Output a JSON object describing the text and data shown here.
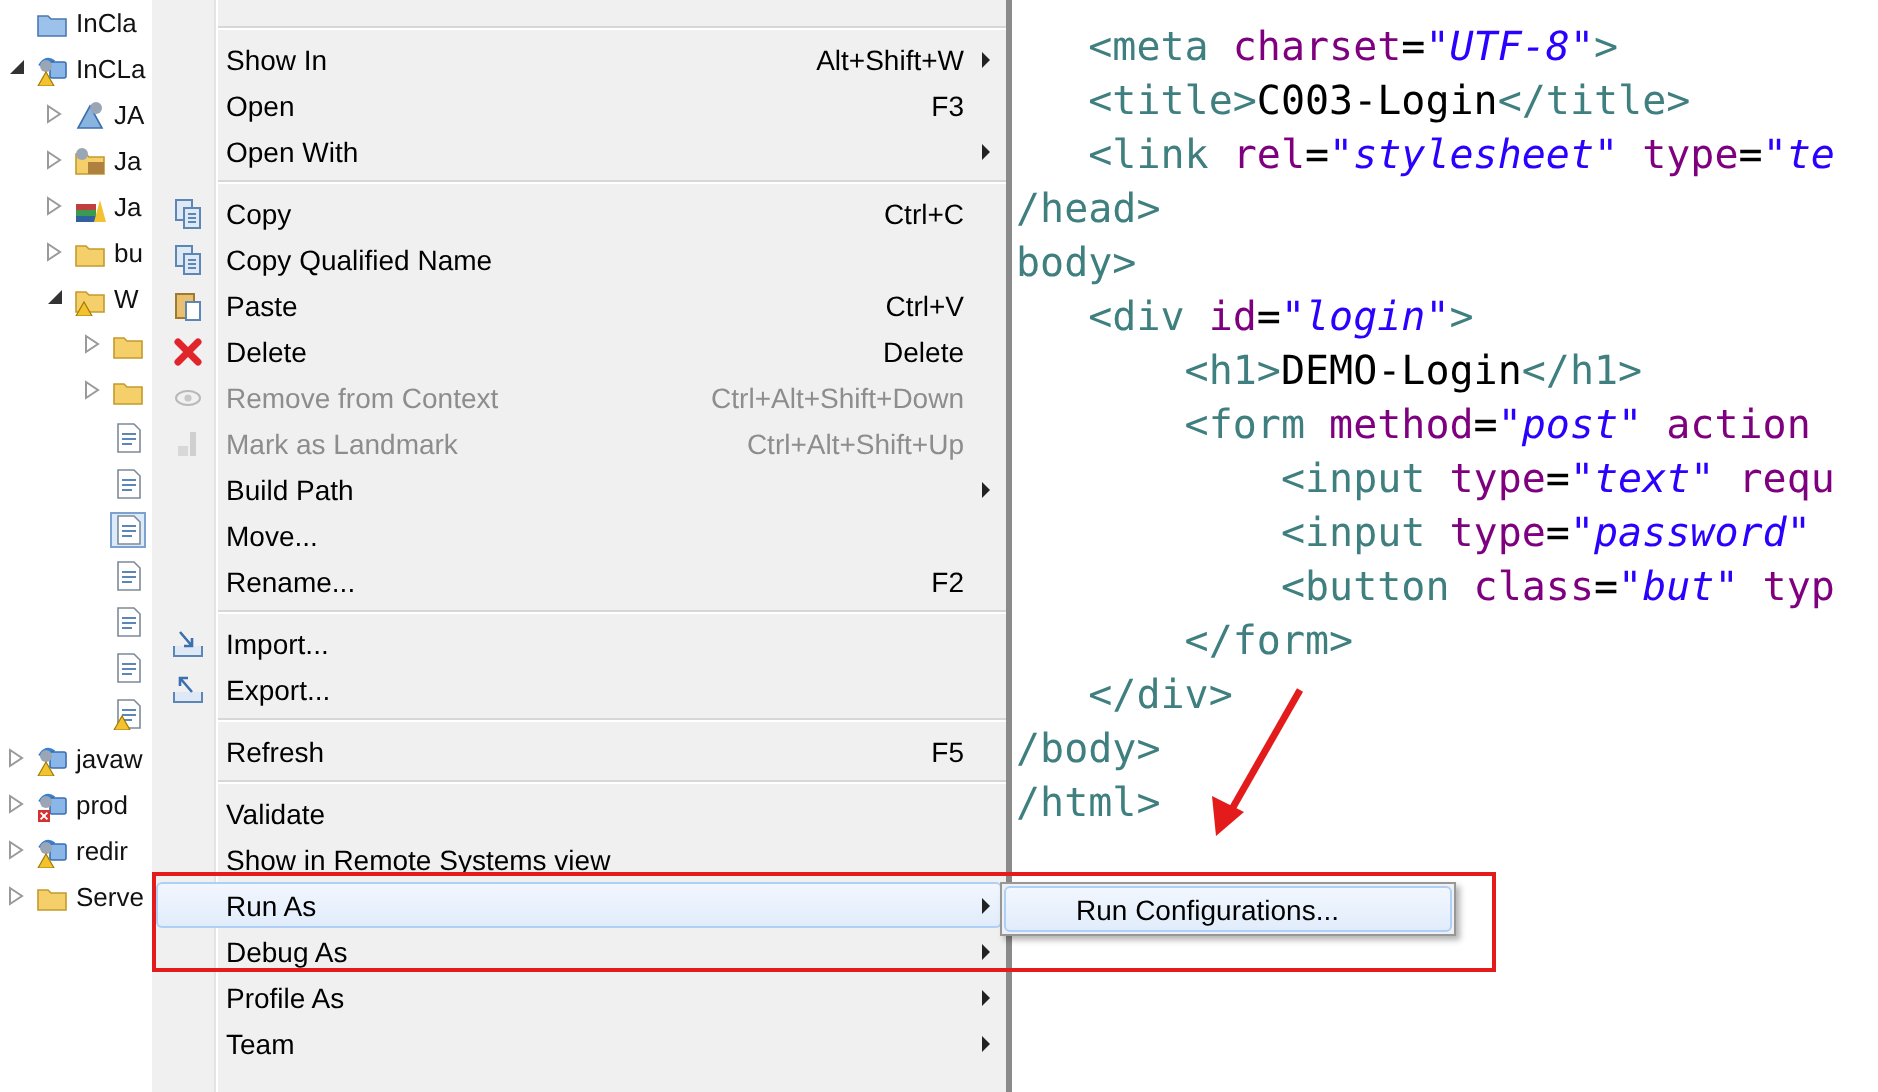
{
  "tree": [
    {
      "label": "InCla",
      "kind": "closed-project",
      "selected": false
    },
    {
      "label": "InCLa",
      "kind": "project-warning",
      "selected": false,
      "expanded": true,
      "children": [
        {
          "label": "JA",
          "kind": "service",
          "selected": false,
          "expanded": false
        },
        {
          "label": "Ja",
          "kind": "resources",
          "selected": false,
          "expanded": false
        },
        {
          "label": "Ja",
          "kind": "library",
          "selected": false,
          "expanded": false
        },
        {
          "label": "bu",
          "kind": "folder",
          "selected": false,
          "expanded": false
        },
        {
          "label": "W",
          "kind": "folder-warning",
          "selected": false,
          "expanded": true,
          "children": [
            {
              "kind": "folder",
              "selected": false,
              "expanded": false
            },
            {
              "kind": "folder",
              "selected": false,
              "expanded": false
            },
            {
              "kind": "file",
              "selected": false
            },
            {
              "kind": "file",
              "selected": false
            },
            {
              "kind": "file",
              "selected": true
            },
            {
              "kind": "file",
              "selected": false
            },
            {
              "kind": "file",
              "selected": false
            },
            {
              "kind": "file",
              "selected": false
            },
            {
              "kind": "file-warning",
              "selected": false
            }
          ]
        }
      ]
    },
    {
      "label": "javaw",
      "kind": "project-warning",
      "selected": false,
      "expanded": false
    },
    {
      "label": "prod",
      "kind": "project-error",
      "selected": false,
      "expanded": false
    },
    {
      "label": "redir",
      "kind": "project-warning",
      "selected": false,
      "expanded": false
    },
    {
      "label": "Serve",
      "kind": "folder",
      "selected": false,
      "expanded": false
    }
  ],
  "menu": {
    "items": [
      {
        "kind": "separator"
      },
      {
        "kind": "item",
        "label": "Show In",
        "shortcut": "Alt+Shift+W",
        "submenu": true,
        "disabled": false,
        "highlighted": false
      },
      {
        "kind": "item",
        "label": "Open",
        "shortcut": "F3",
        "submenu": false,
        "disabled": false,
        "highlighted": false
      },
      {
        "kind": "item",
        "label": "Open With",
        "submenu": true,
        "disabled": false,
        "highlighted": false
      },
      {
        "kind": "separator"
      },
      {
        "kind": "item",
        "label": "Copy",
        "shortcut": "Ctrl+C",
        "submenu": false,
        "disabled": false,
        "highlighted": false
      },
      {
        "kind": "item",
        "label": "Copy Qualified Name",
        "submenu": false,
        "disabled": false,
        "highlighted": false
      },
      {
        "kind": "item",
        "label": "Paste",
        "shortcut": "Ctrl+V",
        "submenu": false,
        "disabled": false,
        "highlighted": false
      },
      {
        "kind": "item",
        "label": "Delete",
        "shortcut": "Delete",
        "submenu": false,
        "disabled": false,
        "highlighted": false
      },
      {
        "kind": "item",
        "label": "Remove from Context",
        "shortcut": "Ctrl+Alt+Shift+Down",
        "submenu": false,
        "disabled": true,
        "highlighted": false
      },
      {
        "kind": "item",
        "label": "Mark as Landmark",
        "shortcut": "Ctrl+Alt+Shift+Up",
        "submenu": false,
        "disabled": true,
        "highlighted": false
      },
      {
        "kind": "item",
        "label": "Build Path",
        "submenu": true,
        "disabled": false,
        "highlighted": false
      },
      {
        "kind": "item",
        "label": "Move...",
        "submenu": false,
        "disabled": false,
        "highlighted": false
      },
      {
        "kind": "item",
        "label": "Rename...",
        "shortcut": "F2",
        "submenu": false,
        "disabled": false,
        "highlighted": false
      },
      {
        "kind": "separator"
      },
      {
        "kind": "item",
        "label": "Import...",
        "submenu": false,
        "disabled": false,
        "highlighted": false
      },
      {
        "kind": "item",
        "label": "Export...",
        "submenu": false,
        "disabled": false,
        "highlighted": false
      },
      {
        "kind": "separator"
      },
      {
        "kind": "item",
        "label": "Refresh",
        "shortcut": "F5",
        "submenu": false,
        "disabled": false,
        "highlighted": false
      },
      {
        "kind": "separator"
      },
      {
        "kind": "item",
        "label": "Validate",
        "submenu": false,
        "disabled": false,
        "highlighted": false
      },
      {
        "kind": "item",
        "label": "Show in Remote Systems view",
        "submenu": false,
        "disabled": false,
        "highlighted": false
      },
      {
        "kind": "item",
        "label": "Run As",
        "submenu": true,
        "disabled": false,
        "highlighted": true
      },
      {
        "kind": "item",
        "label": "Debug As",
        "submenu": true,
        "disabled": false,
        "highlighted": false
      },
      {
        "kind": "item",
        "label": "Profile As",
        "submenu": true,
        "disabled": false,
        "highlighted": false
      },
      {
        "kind": "item",
        "label": "Team",
        "submenu": true,
        "disabled": false,
        "highlighted": false
      }
    ]
  },
  "submenu": {
    "items": [
      {
        "label": "Run Configurations...",
        "highlighted": true
      }
    ]
  },
  "editor": {
    "lines": [
      {
        "tokens": [
          {
            "kind": "tag",
            "text": "   <meta"
          },
          {
            "kind": "attr",
            "text": " charset"
          },
          {
            "kind": "plain",
            "text": "="
          },
          {
            "kind": "value",
            "text": "\"UTF-8\""
          },
          {
            "kind": "tag",
            "text": ">"
          }
        ]
      },
      {
        "tokens": [
          {
            "kind": "tag",
            "text": "   <title>"
          },
          {
            "kind": "plain",
            "text": "C003-Login"
          },
          {
            "kind": "tag",
            "text": "</title>"
          }
        ]
      },
      {
        "tokens": [
          {
            "kind": "tag",
            "text": "   <link"
          },
          {
            "kind": "attr",
            "text": " rel"
          },
          {
            "kind": "plain",
            "text": "="
          },
          {
            "kind": "value",
            "text": "\"stylesheet\""
          },
          {
            "kind": "attr",
            "text": " type"
          },
          {
            "kind": "plain",
            "text": "="
          },
          {
            "kind": "value",
            "text": "\"te"
          }
        ]
      },
      {
        "tokens": [
          {
            "kind": "tag",
            "text": "/head>"
          }
        ]
      },
      {
        "tokens": [
          {
            "kind": "tag",
            "text": "body>"
          }
        ]
      },
      {
        "tokens": [
          {
            "kind": "tag",
            "text": "   <div"
          },
          {
            "kind": "attr",
            "text": " id"
          },
          {
            "kind": "plain",
            "text": "="
          },
          {
            "kind": "value",
            "text": "\"login\""
          },
          {
            "kind": "tag",
            "text": ">"
          }
        ]
      },
      {
        "tokens": [
          {
            "kind": "tag",
            "text": "       <h1>"
          },
          {
            "kind": "plain",
            "text": "DEMO-Login"
          },
          {
            "kind": "tag",
            "text": "</h1>"
          }
        ]
      },
      {
        "tokens": [
          {
            "kind": "tag",
            "text": "       <form"
          },
          {
            "kind": "attr",
            "text": " method"
          },
          {
            "kind": "plain",
            "text": "="
          },
          {
            "kind": "value",
            "text": "\"post\""
          },
          {
            "kind": "attr",
            "text": " action"
          }
        ]
      },
      {
        "tokens": [
          {
            "kind": "tag",
            "text": "           <input"
          },
          {
            "kind": "attr",
            "text": " type"
          },
          {
            "kind": "plain",
            "text": "="
          },
          {
            "kind": "value",
            "text": "\"text\""
          },
          {
            "kind": "attr",
            "text": " requ"
          }
        ]
      },
      {
        "tokens": [
          {
            "kind": "tag",
            "text": "           <input"
          },
          {
            "kind": "attr",
            "text": " type"
          },
          {
            "kind": "plain",
            "text": "="
          },
          {
            "kind": "value",
            "text": "\"password\""
          }
        ]
      },
      {
        "tokens": [
          {
            "kind": "tag",
            "text": "           <button"
          },
          {
            "kind": "attr",
            "text": " class"
          },
          {
            "kind": "plain",
            "text": "="
          },
          {
            "kind": "value",
            "text": "\"but\""
          },
          {
            "kind": "attr",
            "text": " typ"
          }
        ]
      },
      {
        "tokens": [
          {
            "kind": "tag",
            "text": "       </form>"
          }
        ]
      },
      {
        "tokens": [
          {
            "kind": "tag",
            "text": "   </div>"
          }
        ]
      },
      {
        "tokens": [
          {
            "kind": "tag",
            "text": "/body>"
          }
        ]
      },
      {
        "tokens": [
          {
            "kind": "tag",
            "text": "/html>"
          }
        ]
      }
    ]
  }
}
